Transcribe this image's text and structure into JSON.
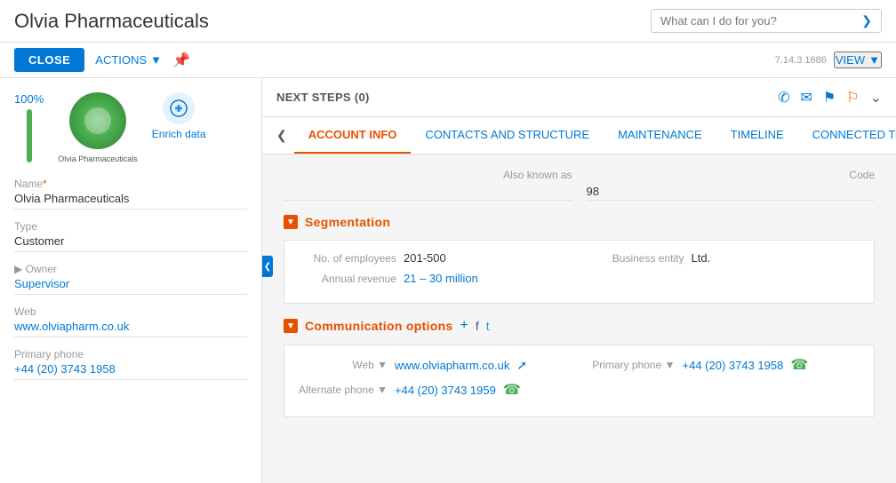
{
  "header": {
    "company_name": "Olvia Pharmaceuticals",
    "search_placeholder": "What can I do for you?",
    "version": "7.14.3.1686"
  },
  "action_bar": {
    "close_label": "CLOSE",
    "actions_label": "ACTIONS",
    "view_label": "VIEW"
  },
  "left_panel": {
    "progress_percent": "100%",
    "enrich_label": "Enrich data",
    "company_logo_alt": "Olvia Pharmaceuticals",
    "fields": [
      {
        "label": "Name*",
        "value": "Olvia Pharmaceuticals",
        "type": "text"
      },
      {
        "label": "Type",
        "value": "Customer",
        "type": "text"
      },
      {
        "label": "Owner",
        "value": "Supervisor",
        "type": "text"
      },
      {
        "label": "Web",
        "value": "www.olviapharm.co.uk",
        "type": "link"
      },
      {
        "label": "Primary phone",
        "value": "+44 (20) 3743 1958",
        "type": "phone"
      }
    ]
  },
  "next_steps": {
    "label": "NEXT STEPS (0)"
  },
  "tabs": [
    {
      "id": "account-info",
      "label": "ACCOUNT INFO",
      "active": true
    },
    {
      "id": "contacts-structure",
      "label": "CONTACTS AND STRUCTURE",
      "active": false
    },
    {
      "id": "maintenance",
      "label": "MAINTENANCE",
      "active": false
    },
    {
      "id": "timeline",
      "label": "TIMELINE",
      "active": false
    },
    {
      "id": "connected",
      "label": "CONNECTED TO",
      "active": false
    }
  ],
  "account_info": {
    "also_known_as_label": "Also known as",
    "also_known_as_value": "",
    "code_label": "Code",
    "code_value": "98",
    "segmentation": {
      "title": "Segmentation",
      "employees_label": "No. of employees",
      "employees_value": "201-500",
      "business_entity_label": "Business entity",
      "business_entity_value": "Ltd.",
      "annual_revenue_label": "Annual revenue",
      "annual_revenue_value": "21 – 30 million"
    },
    "communication": {
      "title": "Communication options",
      "add_icon": "+",
      "web_label": "Web",
      "web_value": "www.olviapharm.co.uk",
      "primary_phone_label": "Primary phone",
      "primary_phone_value": "+44 (20) 3743 1958",
      "alternate_phone_label": "Alternate phone",
      "alternate_phone_value": "+44 (20) 3743 1959"
    }
  }
}
